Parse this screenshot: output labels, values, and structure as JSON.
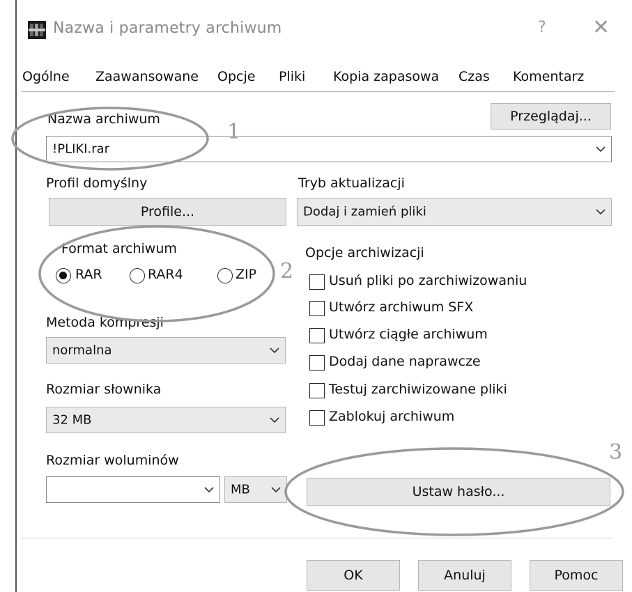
{
  "window": {
    "title": "Nazwa i parametry archiwum",
    "help_label": "?",
    "close_label": "✕",
    "icon": "winrar-books-icon"
  },
  "tabs": [
    {
      "label": "Ogólne",
      "active": true
    },
    {
      "label": "Zaawansowane"
    },
    {
      "label": "Opcje"
    },
    {
      "label": "Pliki"
    },
    {
      "label": "Kopia zapasowa"
    },
    {
      "label": "Czas"
    },
    {
      "label": "Komentarz"
    }
  ],
  "archive_name": {
    "label": "Nazwa archiwum",
    "value": "!PLIKI.rar",
    "browse_label": "Przeglądaj..."
  },
  "profile": {
    "label": "Profil domyślny",
    "button_label": "Profile..."
  },
  "update_mode": {
    "label": "Tryb aktualizacji",
    "value": "Dodaj i zamień pliki"
  },
  "archive_format": {
    "label": "Format archiwum",
    "options": [
      {
        "label": "RAR",
        "selected": true
      },
      {
        "label": "RAR4",
        "selected": false
      },
      {
        "label": "ZIP",
        "selected": false
      }
    ]
  },
  "compression_method": {
    "label": "Metoda kompresji",
    "value": "normalna"
  },
  "dictionary_size": {
    "label": "Rozmiar słownika",
    "value": "32 MB"
  },
  "volume_size": {
    "label": "Rozmiar woluminów",
    "value": "",
    "unit": "MB"
  },
  "archiving_options": {
    "label": "Opcje archiwizacji",
    "items": [
      {
        "label": "Usuń pliki po zarchiwizowaniu",
        "checked": false
      },
      {
        "label": "Utwórz archiwum SFX",
        "checked": false
      },
      {
        "label": "Utwórz ciągłe archiwum",
        "checked": false
      },
      {
        "label": "Dodaj dane naprawcze",
        "checked": false
      },
      {
        "label": "Testuj zarchiwizowane pliki",
        "checked": false
      },
      {
        "label": "Zablokuj archiwum",
        "checked": false
      }
    ]
  },
  "set_password_label": "Ustaw hasło...",
  "footer": {
    "ok_label": "OK",
    "cancel_label": "Anuluj",
    "help_label": "Pomoc"
  },
  "annotations": [
    "1",
    "2",
    "3"
  ],
  "colors": {
    "annotation": "#9a9a9a",
    "button_face": "#e6e6e6"
  }
}
